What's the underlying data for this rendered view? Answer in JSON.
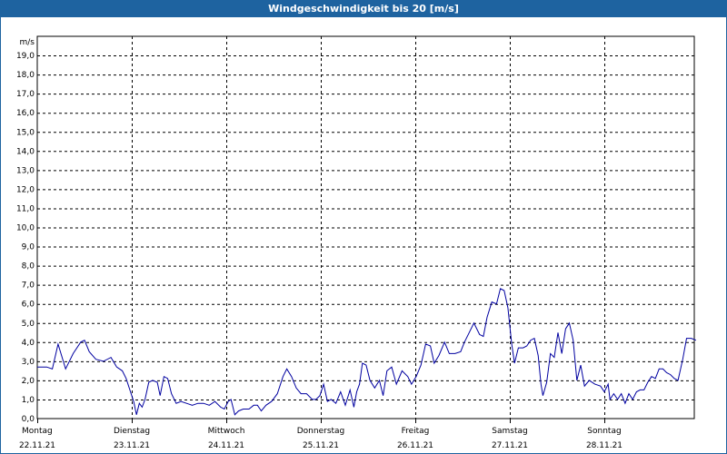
{
  "window": {
    "title": "Windgeschwindigkeit bis 20 [m/s]"
  },
  "chart_data": {
    "type": "line",
    "title": "Windgeschwindigkeit bis 20 [m/s]",
    "ylabel": "m/s",
    "ylim": [
      0,
      20
    ],
    "yticks": [
      "0,0",
      "1,0",
      "2,0",
      "3,0",
      "4,0",
      "5,0",
      "6,0",
      "7,0",
      "8,0",
      "9,0",
      "10,0",
      "11,0",
      "12,0",
      "13,0",
      "14,0",
      "15,0",
      "16,0",
      "17,0",
      "18,0",
      "19,0"
    ],
    "days": [
      {
        "weekday": "Montag",
        "date": "22.11.21"
      },
      {
        "weekday": "Dienstag",
        "date": "23.11.21"
      },
      {
        "weekday": "Mittwoch",
        "date": "24.11.21"
      },
      {
        "weekday": "Donnerstag",
        "date": "25.11.21"
      },
      {
        "weekday": "Freitag",
        "date": "26.11.21"
      },
      {
        "weekday": "Samstag",
        "date": "27.11.21"
      },
      {
        "weekday": "Sonntag",
        "date": "28.11.21"
      }
    ],
    "grid": true,
    "line_color": "#0000a0",
    "series": [
      {
        "x_unit": "days since Montag 22.11.21 00:00",
        "points": [
          [
            0.0,
            2.7
          ],
          [
            0.1,
            2.7
          ],
          [
            0.16,
            2.6
          ],
          [
            0.22,
            3.9
          ],
          [
            0.3,
            2.6
          ],
          [
            0.38,
            3.4
          ],
          [
            0.46,
            4.0
          ],
          [
            0.5,
            4.1
          ],
          [
            0.55,
            3.5
          ],
          [
            0.62,
            3.1
          ],
          [
            0.7,
            3.0
          ],
          [
            0.78,
            3.2
          ],
          [
            0.84,
            2.7
          ],
          [
            0.9,
            2.5
          ],
          [
            0.94,
            2.1
          ],
          [
            0.98,
            1.5
          ],
          [
            1.02,
            0.9
          ],
          [
            1.05,
            0.2
          ],
          [
            1.08,
            0.8
          ],
          [
            1.11,
            0.6
          ],
          [
            1.14,
            1.0
          ],
          [
            1.18,
            1.9
          ],
          [
            1.22,
            2.0
          ],
          [
            1.27,
            1.9
          ],
          [
            1.3,
            1.2
          ],
          [
            1.34,
            2.2
          ],
          [
            1.38,
            2.1
          ],
          [
            1.42,
            1.3
          ],
          [
            1.47,
            0.8
          ],
          [
            1.52,
            0.9
          ],
          [
            1.58,
            0.8
          ],
          [
            1.64,
            0.7
          ],
          [
            1.7,
            0.8
          ],
          [
            1.76,
            0.8
          ],
          [
            1.82,
            0.7
          ],
          [
            1.88,
            0.9
          ],
          [
            1.94,
            0.6
          ],
          [
            1.98,
            0.5
          ],
          [
            2.02,
            0.9
          ],
          [
            2.05,
            1.0
          ],
          [
            2.09,
            0.2
          ],
          [
            2.13,
            0.4
          ],
          [
            2.18,
            0.5
          ],
          [
            2.24,
            0.5
          ],
          [
            2.29,
            0.7
          ],
          [
            2.33,
            0.7
          ],
          [
            2.37,
            0.4
          ],
          [
            2.42,
            0.7
          ],
          [
            2.48,
            0.9
          ],
          [
            2.54,
            1.3
          ],
          [
            2.6,
            2.2
          ],
          [
            2.64,
            2.6
          ],
          [
            2.69,
            2.2
          ],
          [
            2.74,
            1.6
          ],
          [
            2.79,
            1.3
          ],
          [
            2.85,
            1.3
          ],
          [
            2.91,
            1.0
          ],
          [
            2.95,
            1.0
          ],
          [
            2.99,
            1.2
          ],
          [
            3.03,
            1.8
          ],
          [
            3.07,
            0.9
          ],
          [
            3.11,
            1.0
          ],
          [
            3.16,
            0.8
          ],
          [
            3.21,
            1.4
          ],
          [
            3.26,
            0.7
          ],
          [
            3.31,
            1.5
          ],
          [
            3.35,
            0.6
          ],
          [
            3.38,
            1.4
          ],
          [
            3.41,
            1.8
          ],
          [
            3.44,
            2.9
          ],
          [
            3.48,
            2.8
          ],
          [
            3.52,
            2.0
          ],
          [
            3.57,
            1.6
          ],
          [
            3.62,
            2.0
          ],
          [
            3.66,
            1.2
          ],
          [
            3.7,
            2.5
          ],
          [
            3.75,
            2.7
          ],
          [
            3.8,
            1.8
          ],
          [
            3.86,
            2.5
          ],
          [
            3.92,
            2.2
          ],
          [
            3.96,
            1.8
          ],
          [
            4.01,
            2.2
          ],
          [
            4.06,
            2.8
          ],
          [
            4.11,
            3.9
          ],
          [
            4.16,
            3.8
          ],
          [
            4.2,
            2.9
          ],
          [
            4.25,
            3.3
          ],
          [
            4.31,
            4.0
          ],
          [
            4.36,
            3.4
          ],
          [
            4.42,
            3.4
          ],
          [
            4.48,
            3.5
          ],
          [
            4.52,
            4.0
          ],
          [
            4.57,
            4.5
          ],
          [
            4.62,
            5.0
          ],
          [
            4.68,
            4.4
          ],
          [
            4.72,
            4.3
          ],
          [
            4.76,
            5.3
          ],
          [
            4.81,
            6.1
          ],
          [
            4.86,
            6.0
          ],
          [
            4.9,
            6.8
          ],
          [
            4.94,
            6.7
          ],
          [
            4.98,
            5.8
          ],
          [
            5.02,
            3.9
          ],
          [
            5.05,
            2.9
          ],
          [
            5.09,
            3.7
          ],
          [
            5.14,
            3.7
          ],
          [
            5.18,
            3.8
          ],
          [
            5.22,
            4.1
          ],
          [
            5.26,
            4.2
          ],
          [
            5.3,
            3.3
          ],
          [
            5.33,
            1.8
          ],
          [
            5.35,
            1.2
          ],
          [
            5.39,
            1.9
          ],
          [
            5.43,
            3.4
          ],
          [
            5.47,
            3.2
          ],
          [
            5.51,
            4.5
          ],
          [
            5.55,
            3.4
          ],
          [
            5.59,
            4.7
          ],
          [
            5.63,
            5.0
          ],
          [
            5.67,
            4.1
          ],
          [
            5.71,
            2.0
          ],
          [
            5.75,
            2.8
          ],
          [
            5.79,
            1.7
          ],
          [
            5.84,
            2.0
          ],
          [
            5.9,
            1.8
          ],
          [
            5.96,
            1.7
          ],
          [
            6.0,
            1.4
          ],
          [
            6.04,
            1.8
          ],
          [
            6.06,
            1.0
          ],
          [
            6.1,
            1.3
          ],
          [
            6.14,
            1.0
          ],
          [
            6.18,
            1.3
          ],
          [
            6.22,
            0.8
          ],
          [
            6.26,
            1.3
          ],
          [
            6.3,
            1.0
          ],
          [
            6.34,
            1.4
          ],
          [
            6.38,
            1.5
          ],
          [
            6.42,
            1.5
          ],
          [
            6.46,
            1.9
          ],
          [
            6.5,
            2.2
          ],
          [
            6.54,
            2.1
          ],
          [
            6.58,
            2.6
          ],
          [
            6.62,
            2.6
          ],
          [
            6.66,
            2.4
          ],
          [
            6.7,
            2.3
          ],
          [
            6.74,
            2.1
          ],
          [
            6.78,
            2.0
          ],
          [
            6.83,
            3.1
          ],
          [
            6.87,
            4.2
          ],
          [
            6.92,
            4.2
          ],
          [
            6.97,
            4.1
          ]
        ]
      }
    ]
  }
}
